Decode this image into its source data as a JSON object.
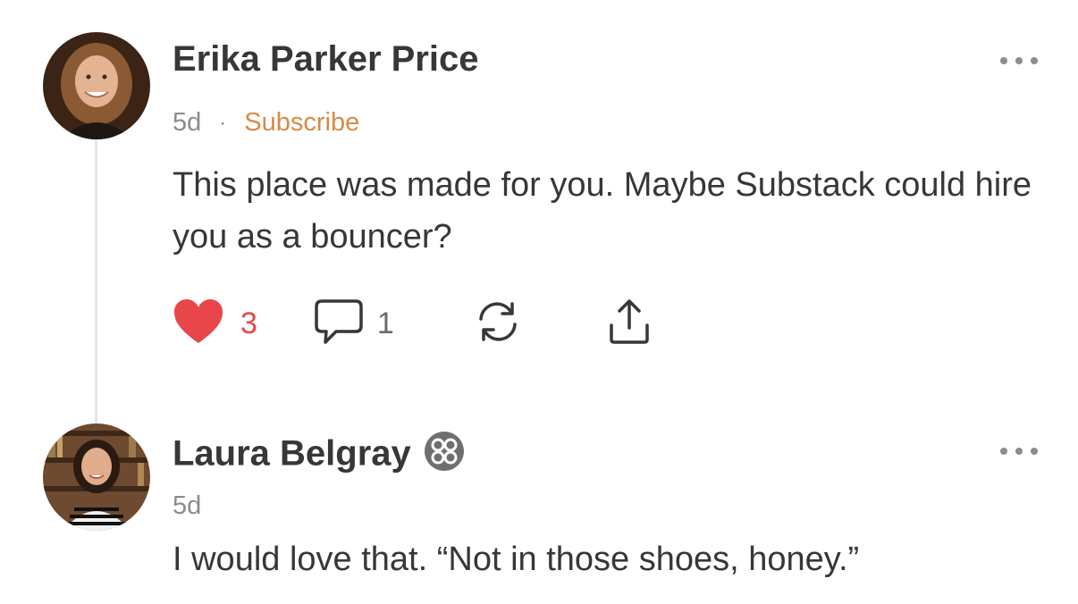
{
  "comments": [
    {
      "author": "Erika Parker Price",
      "time": "5d",
      "separator": "·",
      "subscribe_label": "Subscribe",
      "text": "This place was made for you. Maybe Substack could hire you as a bouncer?",
      "likes": "3",
      "replies": "1"
    },
    {
      "author": "Laura Belgray",
      "time": "5d",
      "text": "I would love that. “Not in those shoes, honey.”"
    }
  ],
  "colors": {
    "like": "#e8464a",
    "subscribe": "#d78a45",
    "text": "#363737",
    "meta": "#8c8c8c"
  },
  "icons": [
    "heart-icon",
    "comment-icon",
    "restack-icon",
    "share-icon",
    "more-icon",
    "verified-badge-icon"
  ]
}
